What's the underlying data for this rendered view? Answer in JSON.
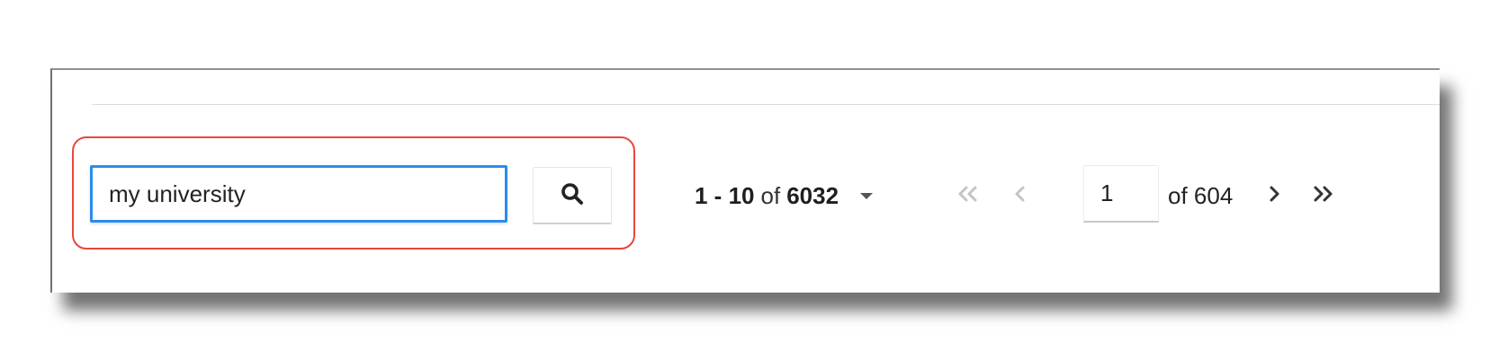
{
  "search": {
    "value": "my university"
  },
  "results": {
    "range": "1 - 10",
    "of": "of",
    "total": "6032"
  },
  "pagination": {
    "current_page": "1",
    "total_pages_label": "of 604"
  },
  "icons": {
    "search": "search-icon",
    "dropdown": "caret-down-icon",
    "first": "double-chevron-left-icon",
    "prev": "chevron-left-icon",
    "next": "chevron-right-icon",
    "last": "double-chevron-right-icon"
  },
  "colors": {
    "highlight": "#e8473d",
    "focus": "#2b8cf0",
    "disabled": "#c4c4c4",
    "enabled": "#333333"
  }
}
